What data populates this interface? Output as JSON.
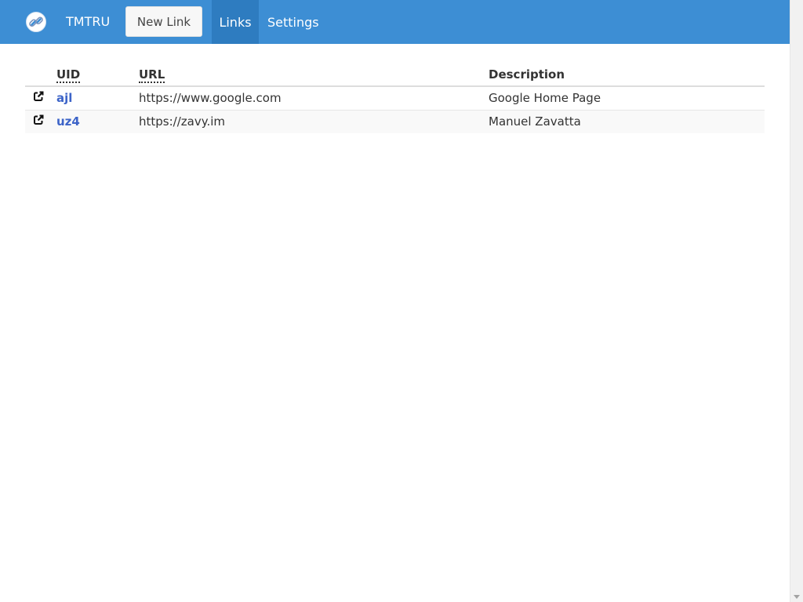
{
  "navbar": {
    "brand": "TMTRU",
    "new_link_label": "New Link",
    "links_label": "Links",
    "settings_label": "Settings",
    "background": "#3d8ed4",
    "active_background": "#2e7cc0"
  },
  "table": {
    "headers": {
      "uid": "UID",
      "url": "URL",
      "description": "Description"
    },
    "rows": [
      {
        "uid": "ajl",
        "url": "https://www.google.com",
        "description": "Google Home Page"
      },
      {
        "uid": "uz4",
        "url": "https://zavy.im",
        "description": "Manuel Zavatta"
      }
    ]
  },
  "icons": {
    "brand": "link-chain-logo-icon",
    "open": "external-link-icon"
  },
  "colors": {
    "uid_link": "#3d64c8"
  }
}
